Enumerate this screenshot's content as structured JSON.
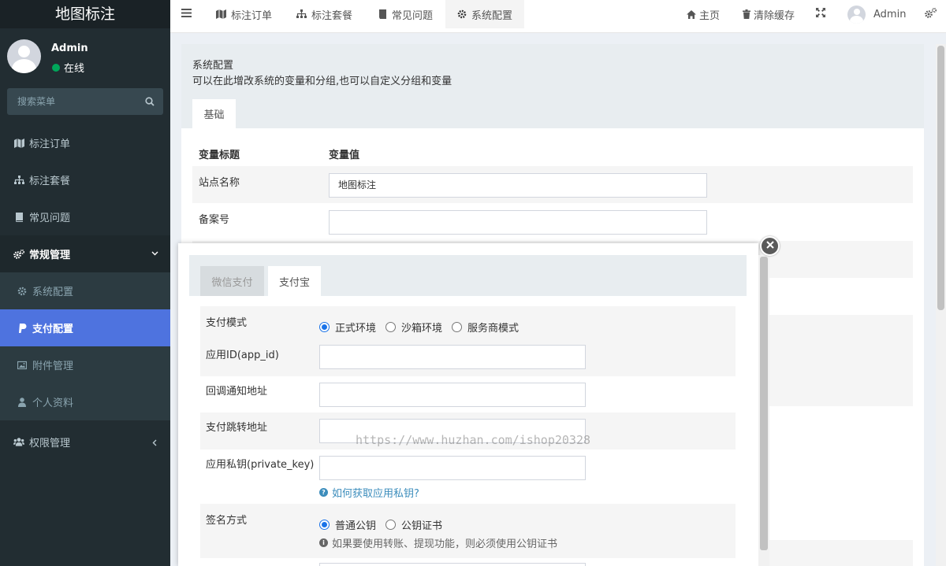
{
  "app": {
    "title": "地图标注"
  },
  "user": {
    "name": "Admin",
    "status": "在线"
  },
  "sidebar": {
    "search_placeholder": "搜索菜单",
    "items": [
      {
        "label": "标注订单",
        "icon": "map-icon"
      },
      {
        "label": "标注套餐",
        "icon": "sitemap-icon"
      },
      {
        "label": "常见问题",
        "icon": "book-icon"
      },
      {
        "label": "常规管理",
        "icon": "cogs-icon"
      },
      {
        "label": "权限管理",
        "icon": "users-icon"
      }
    ],
    "sub_items": [
      {
        "label": "系统配置",
        "icon": "gear-icon"
      },
      {
        "label": "支付配置",
        "icon": "paypal-icon"
      },
      {
        "label": "附件管理",
        "icon": "image-icon"
      },
      {
        "label": "个人资料",
        "icon": "user-icon"
      }
    ]
  },
  "topbar": {
    "tabs": [
      {
        "label": "标注订单",
        "icon": "map-icon"
      },
      {
        "label": "标注套餐",
        "icon": "sitemap-icon"
      },
      {
        "label": "常见问题",
        "icon": "book-icon"
      },
      {
        "label": "系统配置",
        "icon": "gear-icon"
      }
    ],
    "home_label": "主页",
    "clear_cache_label": "清除缓存",
    "user_label": "Admin"
  },
  "config_page": {
    "title": "系统配置",
    "description": "可以在此增改系统的变量和分组,也可以自定义分组和变量",
    "tab": "基础",
    "headers": {
      "title_col": "变量标题",
      "value_col": "变量值"
    },
    "rows": [
      {
        "label": "站点名称",
        "value": "地图标注"
      },
      {
        "label": "备案号",
        "value": ""
      }
    ]
  },
  "modal": {
    "tabs": [
      {
        "label": "微信支付",
        "active": false
      },
      {
        "label": "支付宝",
        "active": true
      }
    ],
    "fields": {
      "mode_label": "支付模式",
      "mode_options": [
        "正式环境",
        "沙箱环境",
        "服务商模式"
      ],
      "mode_selected": "正式环境",
      "app_id_label": "应用ID(app_id)",
      "notify_url_label": "回调通知地址",
      "return_url_label": "支付跳转地址",
      "private_key_label": "应用私钥(private_key)",
      "private_key_help": "如何获取应用私钥?",
      "sign_label": "签名方式",
      "sign_options": [
        "普通公钥",
        "公钥证书"
      ],
      "sign_selected": "普通公钥",
      "sign_help": "如果要使用转账、提现功能，则必须使用公钥证书"
    }
  },
  "watermark": "https://www.huzhan.com/ishop20328",
  "colors": {
    "sidebar_bg": "#222d32",
    "active_menu": "#4e73df",
    "link": "#3c8dbc",
    "radio": "#1a73e8",
    "online": "#00a65a"
  }
}
